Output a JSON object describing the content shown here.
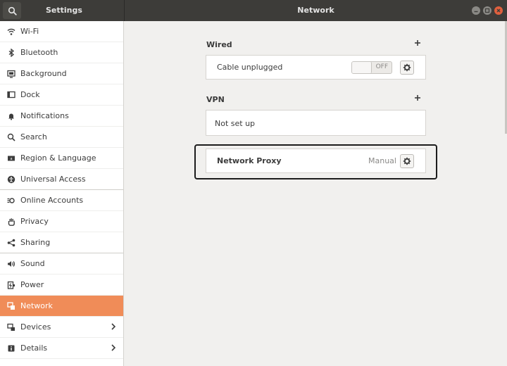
{
  "window": {
    "left_title": "Settings",
    "center_title": "Network"
  },
  "sidebar": {
    "items": [
      {
        "label": "Wi-Fi",
        "icon": "wifi-icon"
      },
      {
        "label": "Bluetooth",
        "icon": "bluetooth-icon"
      },
      {
        "label": "Background",
        "icon": "background-icon"
      },
      {
        "label": "Dock",
        "icon": "dock-icon"
      },
      {
        "label": "Notifications",
        "icon": "bell-icon"
      },
      {
        "label": "Search",
        "icon": "search-icon"
      },
      {
        "label": "Region & Language",
        "icon": "region-icon"
      },
      {
        "label": "Universal Access",
        "icon": "accessibility-icon"
      },
      {
        "label": "Online Accounts",
        "icon": "online-accounts-icon"
      },
      {
        "label": "Privacy",
        "icon": "hand-icon"
      },
      {
        "label": "Sharing",
        "icon": "share-icon"
      },
      {
        "label": "Sound",
        "icon": "speaker-icon"
      },
      {
        "label": "Power",
        "icon": "power-icon"
      },
      {
        "label": "Network",
        "icon": "network-icon",
        "active": true
      },
      {
        "label": "Devices",
        "icon": "devices-icon"
      },
      {
        "label": "Details",
        "icon": "info-icon"
      }
    ],
    "active_color": "#f08c58"
  },
  "wired": {
    "title": "Wired",
    "connection_label": "Cable unplugged",
    "toggle_state": "OFF"
  },
  "vpn": {
    "title": "VPN",
    "status": "Not set up"
  },
  "proxy": {
    "label": "Network Proxy",
    "value": "Manual"
  }
}
